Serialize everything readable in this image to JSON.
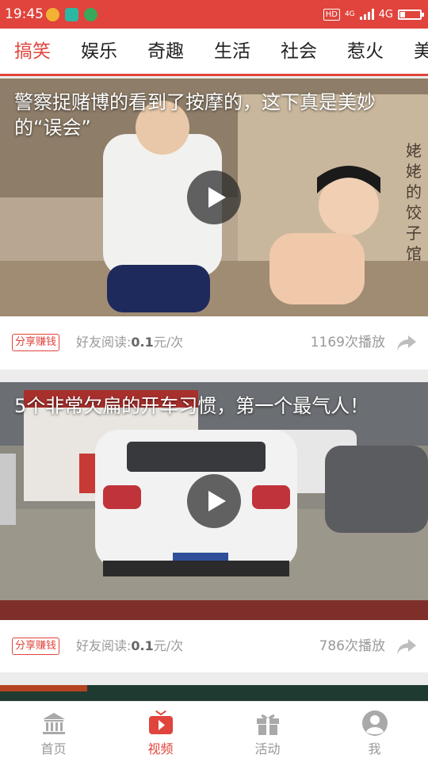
{
  "status_bar": {
    "time": "19:45",
    "network": "4G",
    "hd_badge": "HD",
    "network_small": "4G"
  },
  "tabs": [
    {
      "label": "搞笑",
      "active": true
    },
    {
      "label": "娱乐",
      "active": false
    },
    {
      "label": "奇趣",
      "active": false
    },
    {
      "label": "生活",
      "active": false
    },
    {
      "label": "社会",
      "active": false
    },
    {
      "label": "惹火",
      "active": false
    },
    {
      "label": "美",
      "active": false
    }
  ],
  "videos": [
    {
      "title": "警察捉赌博的看到了按摩的，这下真是美妙的“误会”",
      "share_badge": "分享赚钱",
      "reward_label": "好友阅读:",
      "reward_amount": "0.1",
      "reward_unit": "元/次",
      "play_count": "1169次播放",
      "watermark": "姥姥的饺子馆"
    },
    {
      "title": "5个非常欠扁的开车习惯，第一个最气人！",
      "share_badge": "分享赚钱",
      "reward_label": "好友阅读:",
      "reward_amount": "0.1",
      "reward_unit": "元/次",
      "play_count": "786次播放"
    }
  ],
  "bottom_nav": [
    {
      "label": "首页",
      "icon": "bank-icon",
      "active": false
    },
    {
      "label": "视频",
      "icon": "video-icon",
      "active": true
    },
    {
      "label": "活动",
      "icon": "gift-icon",
      "active": false
    },
    {
      "label": "我",
      "icon": "user-icon",
      "active": false
    }
  ],
  "colors": {
    "accent": "#e0443c",
    "muted_text": "#999999",
    "divider": "#ececec"
  }
}
